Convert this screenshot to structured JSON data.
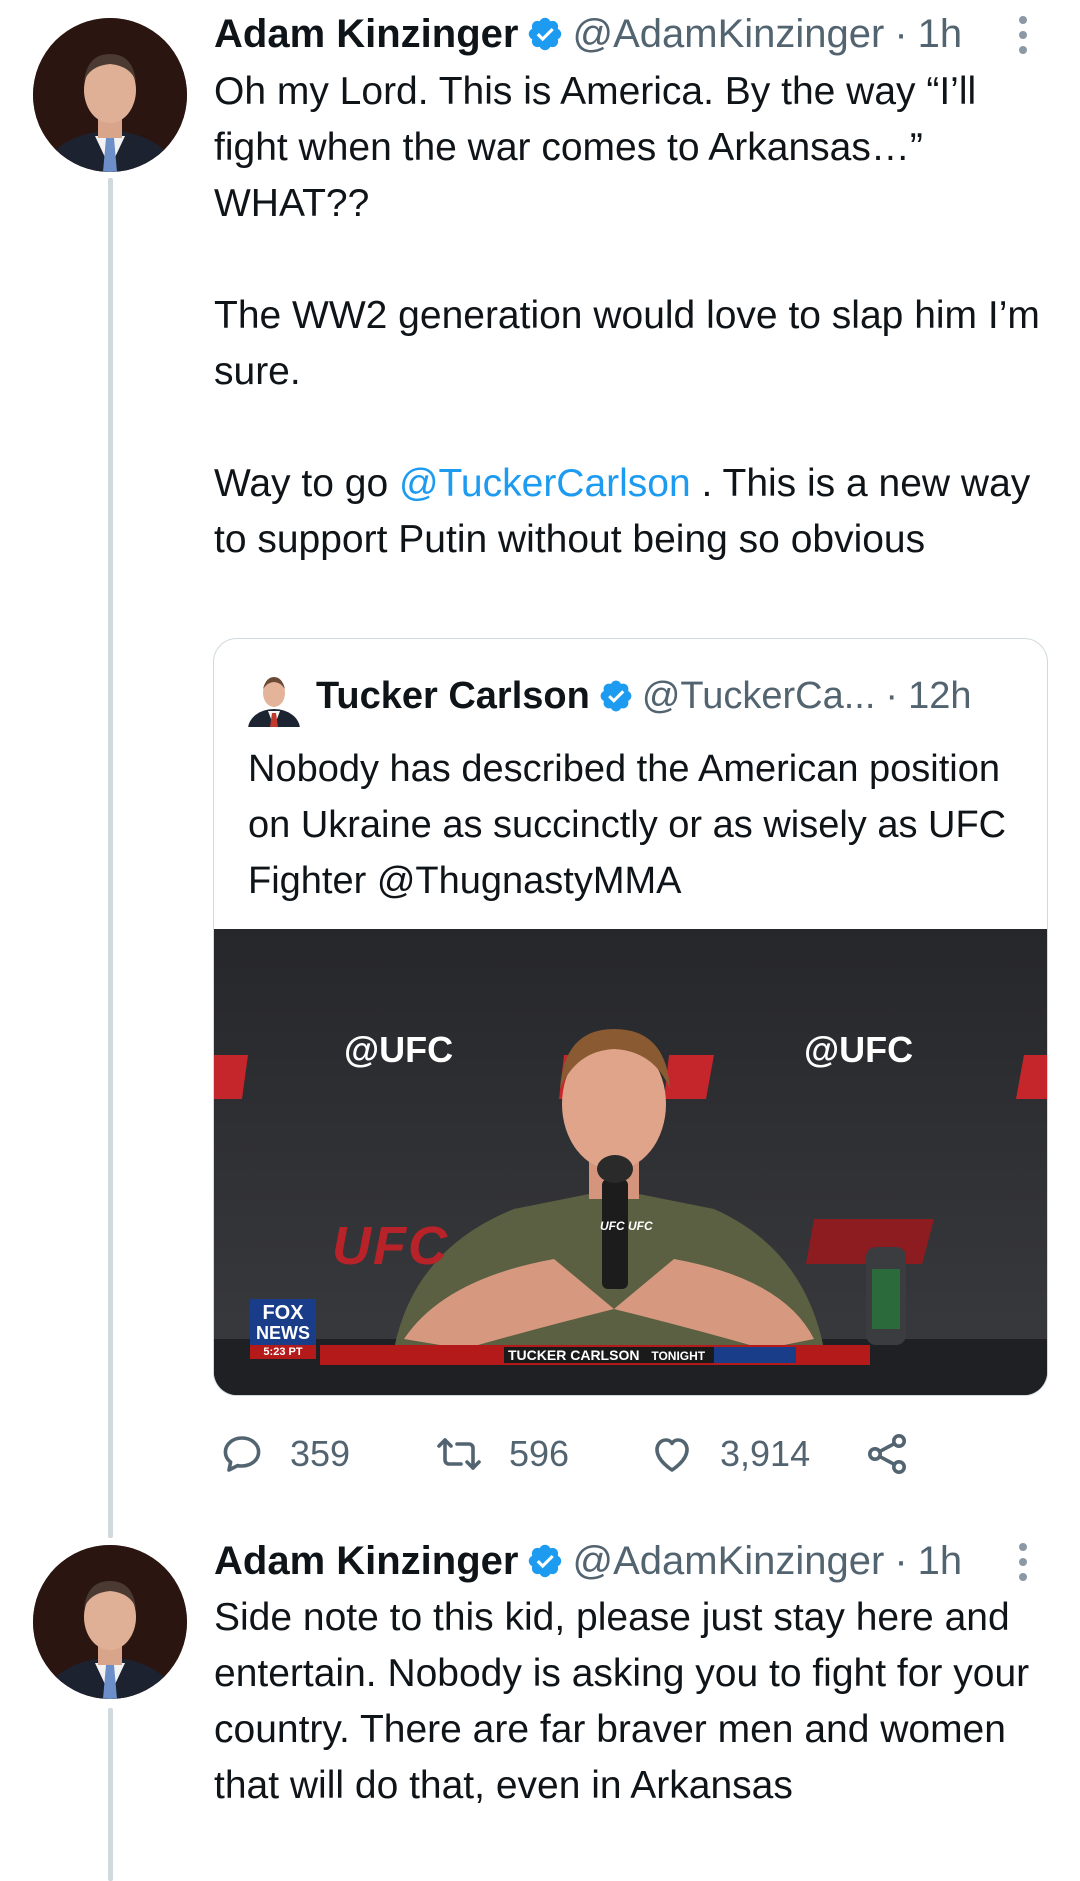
{
  "tweet1": {
    "author_name": "Adam Kinzinger",
    "handle": "@AdamKinzinger",
    "separator": "·",
    "time": "1h",
    "more_icon": "vertical-ellipsis-icon",
    "paragraphs": {
      "p1": "Oh my Lord.  This is America.  By the way “I’ll fight when the war comes to Arkansas…” WHAT??",
      "p2": "The WW2 generation would love to slap him I’m sure.",
      "p3_before": "Way to go ",
      "p3_mention": "@TuckerCarlson",
      "p3_after": " .  This is a new way to support Putin without being so obvious"
    },
    "quote": {
      "author_name": "Tucker Carlson",
      "handle": "@TuckerCa...",
      "separator": "·",
      "time": "12h",
      "text": "Nobody has described the American position on Ukraine as succinctly or as wisely as UFC Fighter @ThugnastyMMA",
      "media": {
        "backdrop_tag_left": "@UFC",
        "backdrop_tag_right": "@UFC",
        "backdrop_logo": "UFC",
        "mic_label": "UFC UFC",
        "network_line1": "FOX",
        "network_line2": "NEWS",
        "broadcast_time": "5:23 PT",
        "show_name_left": "TUCKER CARLSON",
        "show_name_right": "TONIGHT"
      }
    },
    "actions": {
      "replies": "359",
      "retweets": "596",
      "likes": "3,914"
    }
  },
  "tweet2": {
    "author_name": "Adam Kinzinger",
    "handle": "@AdamKinzinger",
    "separator": "·",
    "time": "1h",
    "more_icon": "vertical-ellipsis-icon",
    "text": "Side note to this kid, please just stay here and entertain.  Nobody is asking you to fight for your country.  There are far braver men and women that will do that, even in Arkansas"
  },
  "colors": {
    "link": "#1d9bf0",
    "verified": "#1d9bf0",
    "secondary_text": "#536471",
    "thread_line": "#cfd9de",
    "fox_red": "#b51a1a"
  }
}
